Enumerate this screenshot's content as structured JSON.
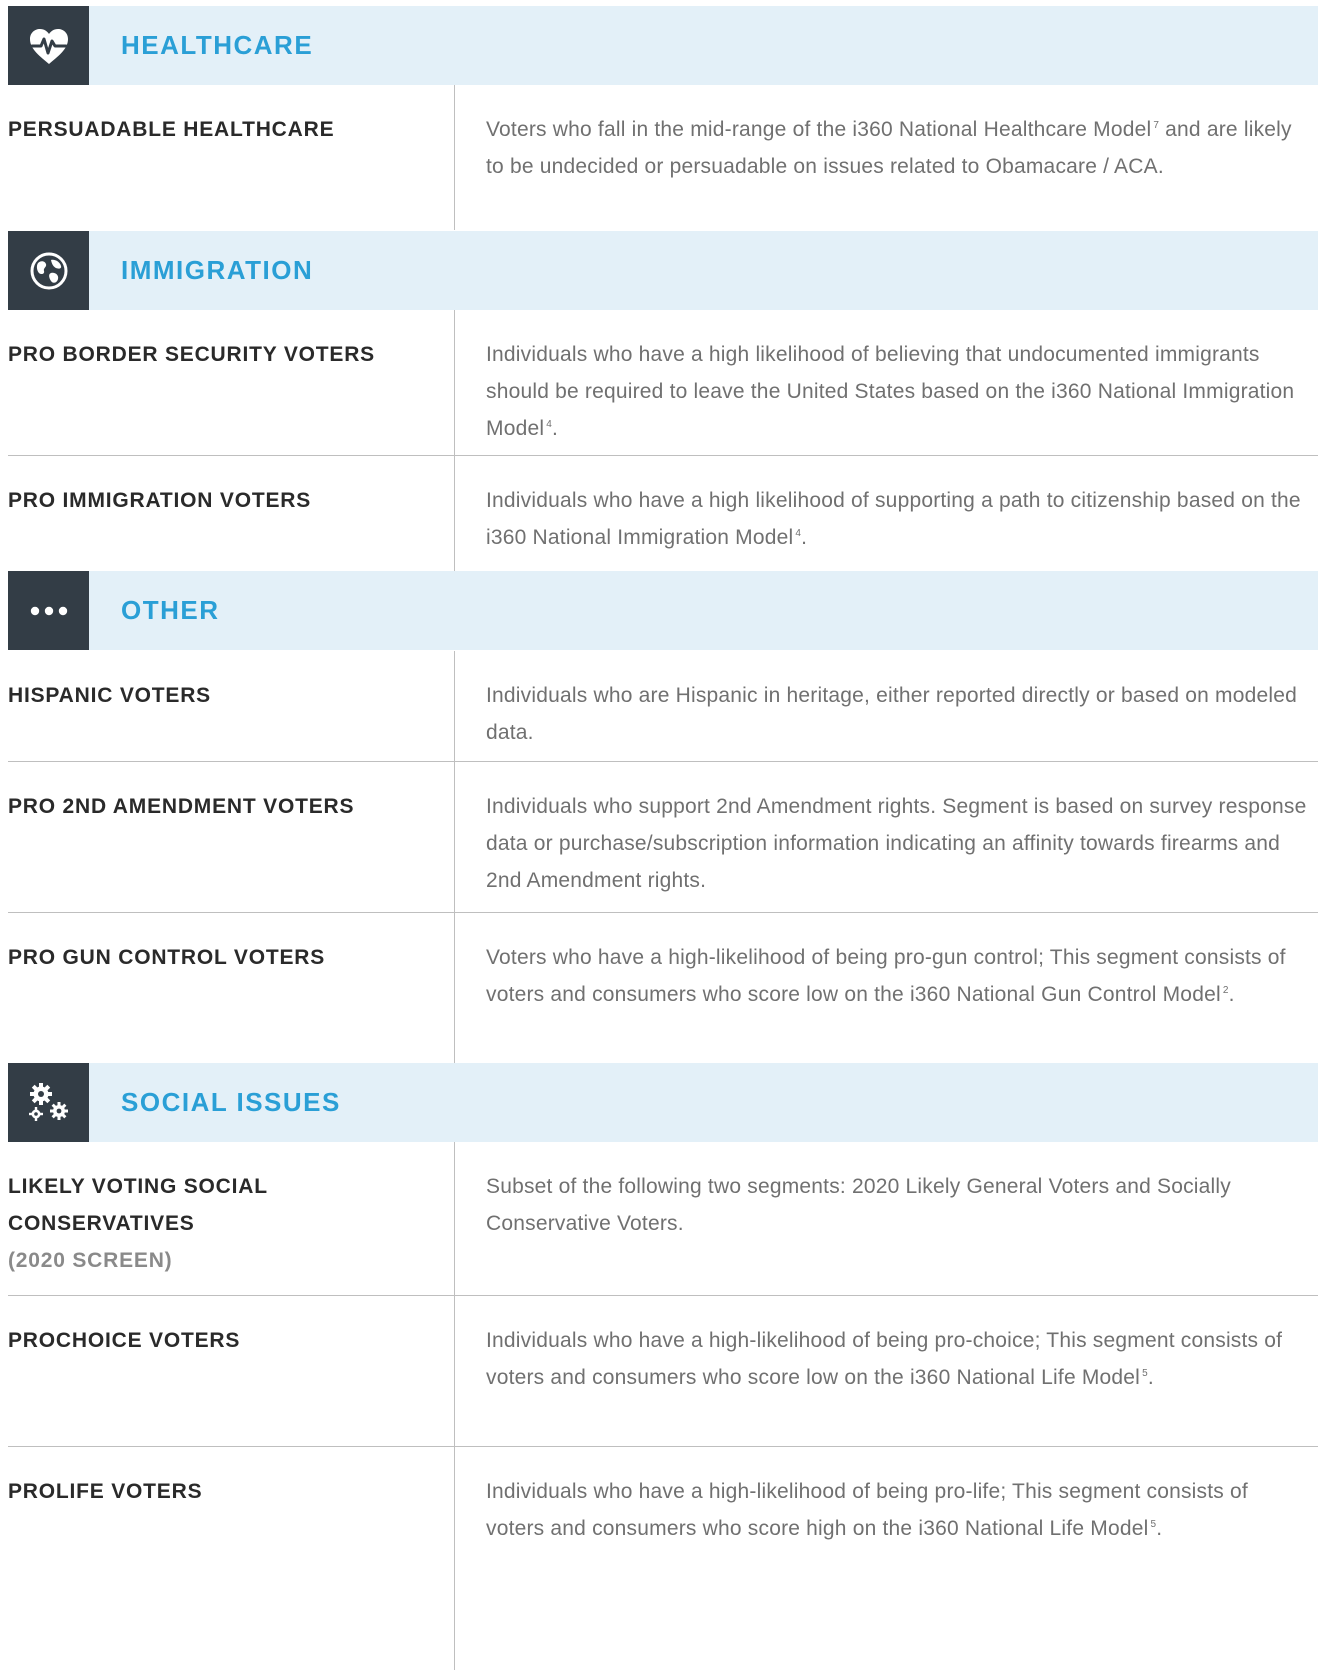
{
  "colors": {
    "header_bg": "#e3f0f8",
    "icon_box_bg": "#333d46",
    "section_title": "#2a9fd6",
    "label_text": "#2a2a2a",
    "sublabel_text": "#8a8a8a",
    "description_text": "#707070",
    "divider": "#bfbfbf"
  },
  "sections": {
    "healthcare": {
      "title": "HEALTHCARE",
      "icon": "heart-pulse-icon",
      "rows": [
        {
          "label": "PERSUADABLE HEALTHCARE",
          "desc_a": "Voters who fall in the mid-range of the i360 National Healthcare Model",
          "sup": "7",
          "desc_b": " and are likely to be undecided or persuadable on issues related to Obamacare / ACA."
        }
      ]
    },
    "immigration": {
      "title": "IMMIGRATION",
      "icon": "globe-icon",
      "rows": [
        {
          "label": "PRO BORDER SECURITY VOTERS",
          "desc_a": "Individuals who have a high likelihood of believing that undocumented immigrants should be required to leave the United States based on the i360 National Immigration Model",
          "sup": "4",
          "desc_b": "."
        },
        {
          "label": "PRO IMMIGRATION VOTERS",
          "desc_a": "Individuals who have a high likelihood of supporting a path to citizenship based on the i360 National Immigration Model",
          "sup": "4",
          "desc_b": "."
        }
      ]
    },
    "other": {
      "title": "OTHER",
      "icon": "ellipsis-icon",
      "rows": [
        {
          "label": "HISPANIC VOTERS",
          "desc_a": "Individuals who are Hispanic in heritage, either reported directly or based on modeled data."
        },
        {
          "label": "PRO 2ND AMENDMENT VOTERS",
          "desc_a": "Individuals who support 2nd Amendment rights. Segment is based on survey response data or purchase/subscription information indicating an affinity towards firearms and 2nd Amendment rights."
        },
        {
          "label": "PRO GUN CONTROL VOTERS",
          "desc_a": "Voters who have a high-likelihood of being pro-gun control; This segment consists of voters and consumers who score low on the i360 National Gun Control Model",
          "sup": "2",
          "desc_b": "."
        }
      ]
    },
    "social": {
      "title": "SOCIAL ISSUES",
      "icon": "gears-icon",
      "rows": [
        {
          "label": "LIKELY VOTING SOCIAL CONSERVATIVES",
          "sublabel": "(2020 SCREEN)",
          "desc_a": "Subset of the following two segments: 2020 Likely General Voters and Socially Conservative Voters."
        },
        {
          "label": "PROCHOICE VOTERS",
          "desc_a": "Individuals who have a high-likelihood of being pro-choice; This segment consists of voters and consumers who score low on the i360 National Life Model",
          "sup": "5",
          "desc_b": "."
        },
        {
          "label": "PROLIFE VOTERS",
          "desc_a": "Individuals who have a high-likelihood of being pro-life; This segment consists of voters and consumers who score high on the i360 National Life Model",
          "sup": "5",
          "desc_b": "."
        }
      ]
    }
  }
}
